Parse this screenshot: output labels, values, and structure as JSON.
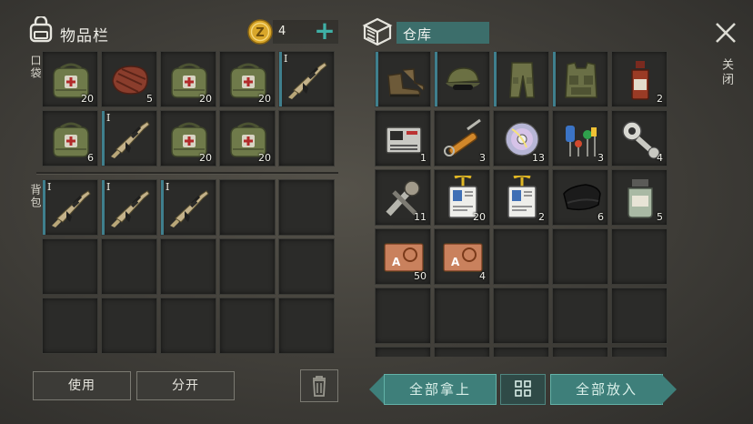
{
  "inventory": {
    "title": "物品栏",
    "coins": "4",
    "pocket_label": "口袋",
    "backpack_label": "背包",
    "pocket_slots": [
      {
        "icon": "medkit-bag-icon",
        "count": "20",
        "tier": ""
      },
      {
        "icon": "steak-icon",
        "count": "5",
        "tier": ""
      },
      {
        "icon": "medkit-bag-icon",
        "count": "20",
        "tier": ""
      },
      {
        "icon": "medkit-bag-icon",
        "count": "20",
        "tier": ""
      },
      {
        "icon": "assault-rifle-icon",
        "count": "",
        "tier": "I",
        "tag": true
      },
      {
        "icon": "medkit-bag-icon",
        "count": "6",
        "tier": ""
      },
      {
        "icon": "assault-rifle-icon",
        "count": "",
        "tier": "I",
        "tag": true
      },
      {
        "icon": "medkit-bag-icon",
        "count": "20",
        "tier": ""
      },
      {
        "icon": "medkit-bag-icon",
        "count": "20",
        "tier": ""
      },
      {
        "icon": "",
        "count": "",
        "tier": ""
      }
    ],
    "backpack_slots": [
      {
        "icon": "assault-rifle-icon",
        "count": "",
        "tier": "I",
        "tag": true
      },
      {
        "icon": "assault-rifle-icon",
        "count": "",
        "tier": "I",
        "tag": true
      },
      {
        "icon": "assault-rifle-icon",
        "count": "",
        "tier": "I",
        "tag": true
      },
      {
        "icon": "",
        "count": "",
        "tier": ""
      },
      {
        "icon": "",
        "count": "",
        "tier": ""
      },
      {
        "icon": "",
        "count": "",
        "tier": ""
      },
      {
        "icon": "",
        "count": "",
        "tier": ""
      },
      {
        "icon": "",
        "count": "",
        "tier": ""
      },
      {
        "icon": "",
        "count": "",
        "tier": ""
      },
      {
        "icon": "",
        "count": "",
        "tier": ""
      },
      {
        "icon": "",
        "count": "",
        "tier": ""
      },
      {
        "icon": "",
        "count": "",
        "tier": ""
      },
      {
        "icon": "",
        "count": "",
        "tier": ""
      },
      {
        "icon": "",
        "count": "",
        "tier": ""
      },
      {
        "icon": "",
        "count": "",
        "tier": ""
      }
    ],
    "use_label": "使用",
    "split_label": "分开"
  },
  "storage": {
    "title": "仓库",
    "slots": [
      {
        "icon": "boots-icon",
        "count": "",
        "tag": true
      },
      {
        "icon": "cap-icon",
        "count": "",
        "tag": true
      },
      {
        "icon": "pants-icon",
        "count": "",
        "tag": true
      },
      {
        "icon": "vest-icon",
        "count": "",
        "tag": true
      },
      {
        "icon": "bottle-icon",
        "count": "2"
      },
      {
        "icon": "device-icon",
        "count": "1"
      },
      {
        "icon": "hydraulic-icon",
        "count": "3"
      },
      {
        "icon": "disc-icon",
        "count": "13"
      },
      {
        "icon": "electronics-icon",
        "count": "3"
      },
      {
        "icon": "gear-part-icon",
        "count": "4"
      },
      {
        "icon": "wrench-part-icon",
        "count": "11"
      },
      {
        "icon": "keycard-icon",
        "count": "20"
      },
      {
        "icon": "keycard-icon",
        "count": "2"
      },
      {
        "icon": "cloth-icon",
        "count": "6"
      },
      {
        "icon": "jar-icon",
        "count": "5"
      },
      {
        "icon": "biohazard-card-icon",
        "count": "50"
      },
      {
        "icon": "biohazard-card-icon",
        "count": "4"
      },
      {
        "icon": "",
        "count": ""
      },
      {
        "icon": "",
        "count": ""
      },
      {
        "icon": "",
        "count": ""
      },
      {
        "icon": "",
        "count": ""
      },
      {
        "icon": "",
        "count": ""
      },
      {
        "icon": "",
        "count": ""
      },
      {
        "icon": "",
        "count": ""
      },
      {
        "icon": "",
        "count": ""
      },
      {
        "icon": "",
        "count": ""
      },
      {
        "icon": "",
        "count": ""
      },
      {
        "icon": "",
        "count": ""
      },
      {
        "icon": "",
        "count": ""
      },
      {
        "icon": "",
        "count": ""
      }
    ],
    "take_all_label": "全部拿上",
    "store_all_label": "全部放入"
  },
  "close_label": "关闭",
  "colors": {
    "accent": "#3e7f7a",
    "tag": "#3f7f8d",
    "coin": "#d9a72a"
  }
}
